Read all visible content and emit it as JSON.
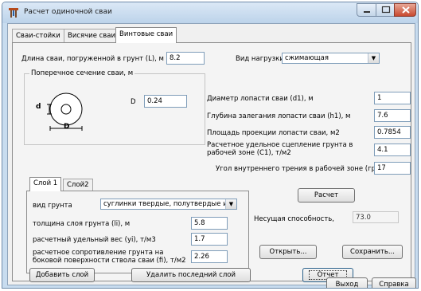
{
  "window": {
    "title": "Расчет одиночной сваи"
  },
  "tabs": [
    "Сваи-стойки",
    "Висячие сваи",
    "Винтовые сваи"
  ],
  "pile": {
    "length_label": "Длина сваи, погруженной в грунт (L), м",
    "length_value": "8.2",
    "load_type_label": "Вид нагрузки",
    "load_type_value": "сжимающая"
  },
  "cross_section": {
    "title": "Поперечное сечение сваи, м",
    "d_label": "d",
    "big_d_label": "D",
    "D_field_label": "D",
    "D_value": "0.24"
  },
  "blade": {
    "d1_label": "Диаметр лопасти сваи (d1), м",
    "d1_value": "1",
    "h1_label": "Глубина залегания лопасти сваи (h1), м",
    "h1_value": "7.6",
    "area_label": "Площадь проекции лопасти сваи, м2",
    "area_value": "0.7854",
    "c1_label": "Расчетное удельное сцепление грунта в рабочей зоне (С1), т/м2",
    "c1_value": "4.1",
    "phi_label": "Угол внутреннего трения в рабочей зоне (градусы)",
    "phi_value": "17"
  },
  "layers": {
    "tabs": [
      "Слой 1",
      "Слой2"
    ],
    "soil_type_label": "вид грунта",
    "soil_type_value": "суглинки твердые, полутвердые и ту",
    "thickness_label": "толщина слоя грунта (li), м",
    "thickness_value": "5.8",
    "weight_label": "расчетный удельный вес (yi), т/м3",
    "weight_value": "1.7",
    "resistance_label": "расчетное сопротивление грунта на боковой поверхности ствола сваи (fi), т/м2",
    "resistance_value": "2.26"
  },
  "buttons": {
    "add_layer": "Добавить слой",
    "remove_layer": "Удалить последний слой",
    "calculate": "Расчет",
    "open": "Открыть...",
    "save": "Сохранить...",
    "report": "Отчет",
    "exit": "Выход",
    "help": "Справка"
  },
  "result": {
    "label": "Несущая способность,",
    "value": "73.0"
  },
  "colors": {
    "accent": "#2c628b",
    "close": "#c8492f",
    "frame": "#c8dcef"
  }
}
